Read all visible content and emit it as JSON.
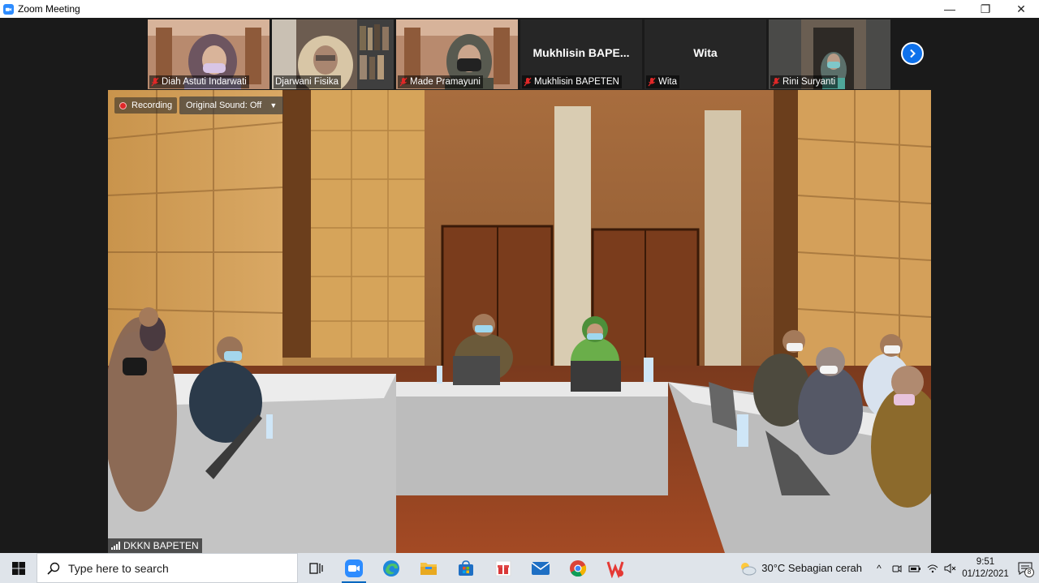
{
  "window": {
    "title": "Zoom Meeting",
    "controls": {
      "minimize": "—",
      "restore": "❐",
      "close": "✕"
    }
  },
  "participants": [
    {
      "name": "Diah Astuti Indarwati",
      "muted": true,
      "video": true
    },
    {
      "name": "Djarwani Fisika",
      "muted": false,
      "video": true
    },
    {
      "name": "Made Pramayuni",
      "muted": true,
      "video": true
    },
    {
      "name": "Mukhlisin BAPETEN",
      "display_name": "Mukhlisin  BAPE...",
      "muted": true,
      "video": false
    },
    {
      "name": "Wita",
      "display_name": "Wita",
      "muted": true,
      "video": false
    },
    {
      "name": "Rini Suryanti",
      "muted": true,
      "video": true
    }
  ],
  "main_video": {
    "recording_label": "Recording",
    "sound_label": "Original Sound: Off",
    "speaker_name": "DKKN BAPETEN"
  },
  "taskbar": {
    "search_placeholder": "Type here to search",
    "weather": "30°C  Sebagian cerah",
    "time": "9:51",
    "date": "01/12/2021",
    "notification_count": "8",
    "pinned_apps": [
      "task-view",
      "zoom",
      "edge",
      "file-explorer",
      "microsoft-store",
      "gift-app",
      "mail",
      "chrome",
      "wps-office"
    ]
  },
  "colors": {
    "zoom_blue": "#2d8cff",
    "next_button": "#0e71eb",
    "muted_red": "#e02828",
    "taskbar_bg": "#dfe4ea"
  }
}
